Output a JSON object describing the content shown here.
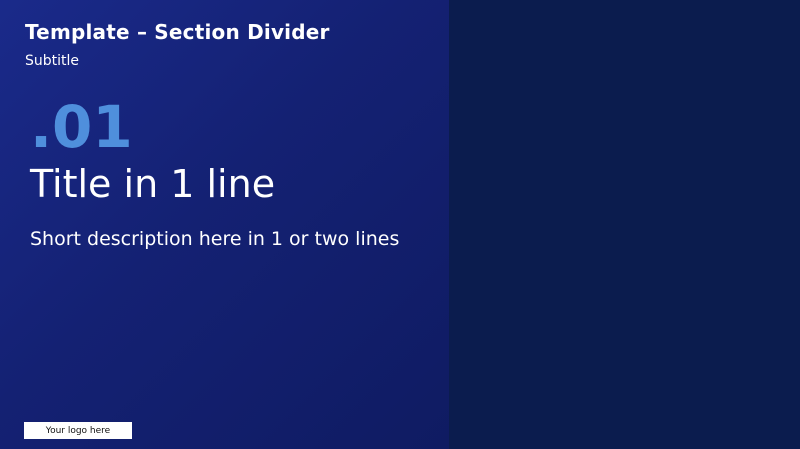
{
  "header": {
    "title": "Template – Section Divider",
    "subtitle": "Subtitle"
  },
  "section": {
    "number": ".01",
    "title": "Title in 1 line",
    "description": "Short description here in 1 or two lines"
  },
  "footer": {
    "logo_text": "Your logo here"
  },
  "colors": {
    "left_panel": "#142173",
    "right_panel": "#0b1c4e",
    "accent_number": "#4f8fdc",
    "text": "#ffffff",
    "logo_box": "#ffffff"
  }
}
